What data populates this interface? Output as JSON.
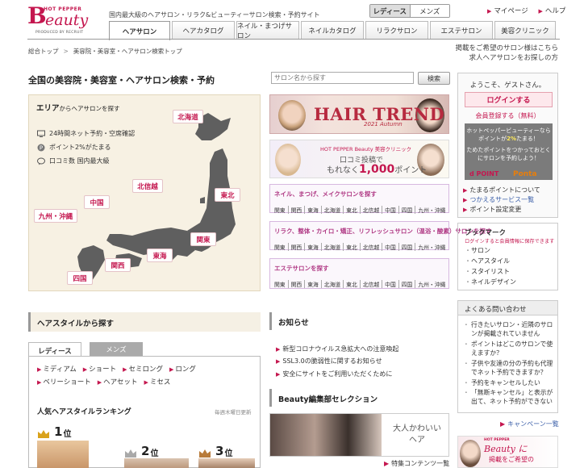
{
  "header": {
    "logo_hp": "HOT PEPPER",
    "logo_word": "eauty",
    "logo_produced": "PRODUCED BY RECRUIT",
    "tagline": "国内最大級のヘアサロン・リラク&ビューティーサロン検索・予約サイト",
    "gender": {
      "ladies": "レディース",
      "mens": "メンズ"
    },
    "links": [
      "マイページ",
      "ヘルプ"
    ]
  },
  "nav": {
    "tabs": [
      {
        "label": "ヘアサロン",
        "w": 76,
        "active": true
      },
      {
        "label": "ヘアカタログ",
        "w": 78
      },
      {
        "label": "ネイル・まつげサロン",
        "w": 78
      },
      {
        "label": "ネイルカタログ",
        "w": 78
      },
      {
        "label": "リラクサロン",
        "w": 78
      },
      {
        "label": "エステサロン",
        "w": 78
      },
      {
        "label": "美容クリニック",
        "w": 76
      }
    ]
  },
  "breadcrumb": [
    "総合トップ",
    "美容院・美容室・ヘアサロン検索トップ"
  ],
  "lookfor": {
    "line1": "掲載をご希望のサロン様はこちら",
    "line2": "求人ヘアサロンをお探しの方"
  },
  "search": {
    "title": "全国の美容院・美容室・ヘアサロン検索・予約",
    "placeholder": "サロン名から探す",
    "button": "検索"
  },
  "area": {
    "title_main": "エリア",
    "title_sub": "からヘアサロンを探す",
    "features": [
      "24時間ネット予約・空席確認",
      "ポイント2%がたまる",
      "口コミ数 国内最大級"
    ],
    "regions": {
      "hokkaido": "北海道",
      "tohoku": "東北",
      "hokushinetsu": "北信越",
      "chugoku": "中国",
      "kyushu": "九州・沖縄",
      "kanto": "関東",
      "kansai": "関西",
      "tokai": "東海",
      "shikoku": "四国"
    }
  },
  "banners": {
    "hairtrend": "HAIR TREND",
    "hairtrend_sub": "2021 Autumn",
    "clinic_label": "HOT PEPPER Beauty 美容クリニック",
    "clinic_line1": "口コミ投稿で",
    "clinic_line2_pre": "もれなく",
    "clinic_line2_num": "1,000",
    "clinic_line2_post": "ポイント"
  },
  "salon_boxes": [
    {
      "title": "ネイル、まつげ、メイクサロンを探す",
      "areas": [
        "関東",
        "関西",
        "東海",
        "北海道",
        "東北",
        "北信越",
        "中国",
        "四国",
        "九州・沖縄"
      ]
    },
    {
      "title": "リラク、整体・カイロ・矯正、リフレッシュサロン（温浴・酸素）サロンを探す",
      "areas": [
        "関東",
        "関西",
        "東海",
        "北海道",
        "東北",
        "北信越",
        "中国",
        "四国",
        "九州・沖縄"
      ]
    },
    {
      "title": "エステサロンを探す",
      "areas": [
        "関東",
        "関西",
        "東海",
        "北海道",
        "東北",
        "北信越",
        "中国",
        "四国",
        "九州・沖縄"
      ]
    }
  ],
  "side": {
    "welcome": "ようこそ、ゲストさん。",
    "login": "ログインする",
    "register": "会員登録する（無料）",
    "ponta_line1_pre": "ホットペッパービューティーなら",
    "ponta_line1_mid": "ポイントが",
    "ponta_line1_pct": "2%",
    "ponta_line1_post": "たまる！",
    "ponta_line2a": "ためたポイントをつかっておとく",
    "ponta_line2b": "にサロンを予約しよう！",
    "dpoint": "d POINT",
    "ponta": "Ponta",
    "links": [
      "たまるポイントについて",
      "つかえるサービス一覧",
      "ポイント設定変更"
    ],
    "bookmark_title": "ブックマーク",
    "bookmark_note": "ログインすると会員情報に保存できます",
    "bookmark_items": [
      "サロン",
      "ヘアスタイル",
      "スタイリスト",
      "ネイルデザイン"
    ],
    "faq_title": "よくある問い合わせ",
    "faq": [
      "行きたいサロン・近隣のサロンが掲載されていません",
      "ポイントはどこのサロンで使えますか？",
      "子供や友達の分の予約も代理でネット予約できますか？",
      "予約をキャンセルしたい",
      "「無断キャンセル」と表示が出て、ネット予約ができない"
    ],
    "campaign": "キャンペーン一覧",
    "banner_hp": "HOT PEPPER",
    "banner_logo": "Beauty に",
    "banner_text": "掲載をご希望の"
  },
  "hairstyle": {
    "title": "ヘアスタイルから探す",
    "tab_ladies": "レディース",
    "tab_mens": "メンズ",
    "cats": [
      "ミディアム",
      "ショート",
      "セミロング",
      "ロング",
      "ベリーショート",
      "ヘアセット",
      "ミセス"
    ],
    "rank_title": "人気ヘアスタイルランキング",
    "rank_note": "毎週木曜日更新",
    "ranks": [
      "1",
      "2",
      "3"
    ],
    "rank_suffix": "位"
  },
  "news": {
    "title": "お知らせ",
    "items": [
      "新型コロナウイルス急拡大への注意喚起",
      "SSL3.0の脆弱性に関するお知らせ",
      "安全にサイトをご利用いただくために"
    ],
    "selection_title": "Beauty編集部セレクション",
    "selection_text": "大人かわいい ヘア",
    "feature_list": "特集コンテンツ一覧"
  },
  "colors": {
    "brand": "#c4174f",
    "link_blue": "#3a5ea8",
    "map_bg": "#f7f1e3"
  }
}
